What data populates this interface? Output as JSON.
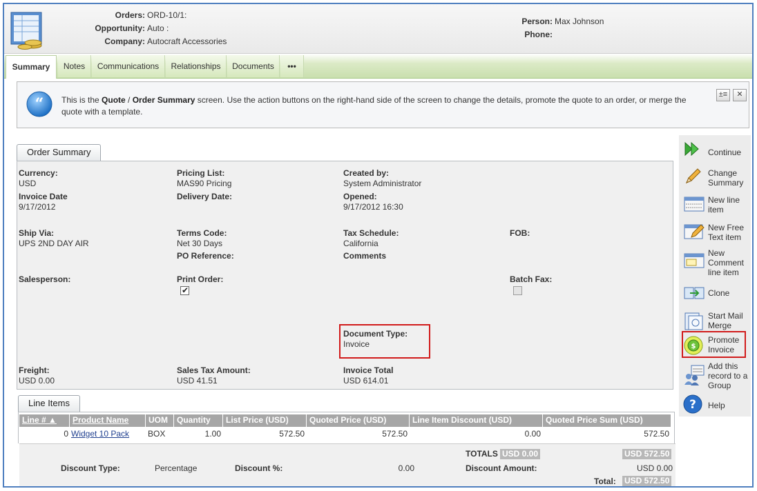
{
  "header": {
    "orders_label": "Orders:",
    "orders_value": "ORD-10/1:",
    "opportunity_label": "Opportunity:",
    "opportunity_value": "Auto :",
    "company_label": "Company:",
    "company_value": "Autocraft Accessories",
    "person_label": "Person:",
    "person_value": "Max Johnson",
    "phone_label": "Phone:",
    "phone_value": ""
  },
  "tabs": [
    {
      "label": "Summary",
      "active": true
    },
    {
      "label": "Notes"
    },
    {
      "label": "Communications"
    },
    {
      "label": "Relationships"
    },
    {
      "label": "Documents"
    },
    {
      "label": "•••"
    }
  ],
  "info": {
    "p1": "This is the ",
    "b1": "Quote",
    "p2": " / ",
    "b2": "Order Summary",
    "p3": " screen. Use the action buttons on the right-hand side of the screen to change the details, promote the quote to an order, or merge the quote with a template.",
    "btn_expand": "±≡",
    "btn_close": "✕"
  },
  "summary": {
    "tab_label": "Order Summary",
    "currency_label": "Currency:",
    "currency_value": "USD",
    "pricing_label": "Pricing List:",
    "pricing_value": "MAS90 Pricing",
    "created_label": "Created by:",
    "created_value": "System Administrator",
    "invoice_date_label": "Invoice Date",
    "invoice_date_value": "9/17/2012",
    "delivery_label": "Delivery Date:",
    "delivery_value": "",
    "opened_label": "Opened:",
    "opened_value": "9/17/2012 16:30",
    "ship_label": "Ship Via:",
    "ship_value": "UPS 2ND DAY AIR",
    "terms_label": "Terms Code:",
    "terms_value": "Net 30 Days",
    "tax_label": "Tax Schedule:",
    "tax_value": "California",
    "fob_label": "FOB:",
    "po_label": "PO Reference:",
    "comments_label": "Comments",
    "salesperson_label": "Salesperson:",
    "print_label": "Print Order:",
    "print_checked": true,
    "batch_label": "Batch Fax:",
    "batch_checked": false,
    "doctype_label": "Document Type:",
    "doctype_value": "Invoice",
    "freight_label": "Freight:",
    "freight_value": "USD 0.00",
    "salestax_label": "Sales Tax Amount:",
    "salestax_value": "USD 41.51",
    "total_label": "Invoice Total",
    "total_value": "USD 614.01"
  },
  "line_items": {
    "tab_label": "Line Items",
    "columns": [
      "Line # ▲",
      "Product Name",
      "UOM",
      "Quantity",
      "List Price (USD)",
      "Quoted Price (USD)",
      "Line Item Discount (USD)",
      "Quoted Price Sum (USD)"
    ],
    "rows": [
      {
        "line": "0",
        "product": "Widget 10 Pack",
        "uom": "BOX",
        "qty": "1.00",
        "list": "572.50",
        "quoted": "572.50",
        "discount": "0.00",
        "sum": "572.50"
      }
    ]
  },
  "totals": {
    "totals_label": "TOTALS",
    "totals_badge": "USD 0.00",
    "totals_sum": "USD 572.50",
    "discount_type_label": "Discount Type:",
    "discount_type_value": "Percentage",
    "discount_pct_label": "Discount %:",
    "discount_pct_value": "0.00",
    "discount_amount_label": "Discount Amount:",
    "discount_amount_value": "USD 0.00",
    "total_label": "Total:",
    "total_value": "USD 572.50"
  },
  "actions": [
    {
      "label": "Continue",
      "icon": "continue-icon"
    },
    {
      "label": "Change Summary",
      "icon": "pencil-icon"
    },
    {
      "label": "New line item",
      "icon": "line-item-icon"
    },
    {
      "label": "New Free Text item",
      "icon": "free-text-icon"
    },
    {
      "label": "New Comment line item",
      "icon": "comment-item-icon"
    },
    {
      "label": "Clone",
      "icon": "clone-icon"
    },
    {
      "label": "Start Mail Merge",
      "icon": "mail-merge-icon"
    },
    {
      "label": "Promote Invoice",
      "icon": "promote-icon"
    },
    {
      "label": "Add this record to a Group",
      "icon": "group-icon"
    },
    {
      "label": "Help",
      "icon": "help-icon"
    }
  ],
  "colors": {
    "frame": "#4f7fbf",
    "tab_green": "#c9dfae",
    "highlight_red": "#d11a1a",
    "grid_header": "#a6a6a6"
  }
}
